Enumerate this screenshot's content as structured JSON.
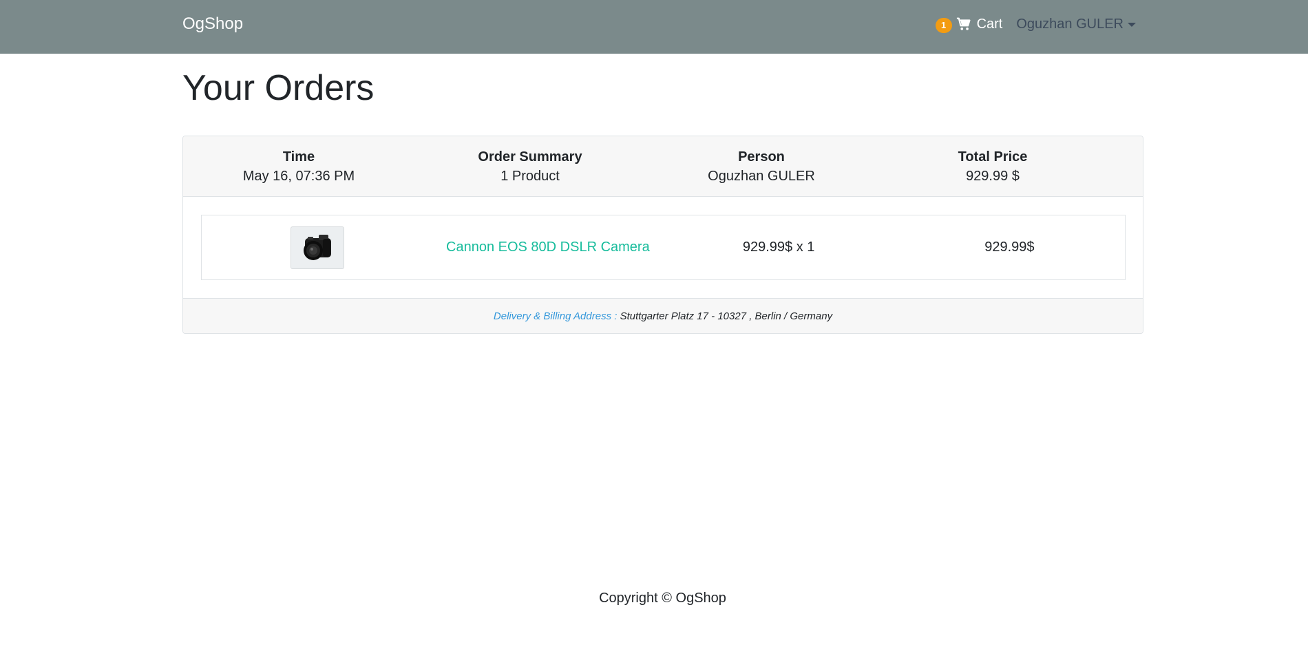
{
  "navbar": {
    "brand": "OgShop",
    "cart_count": "1",
    "cart_label": "Cart",
    "user_name": "Oguzhan GULER",
    "icons": {
      "cart": "shopping-cart-icon",
      "user_menu": "caret-down-icon"
    }
  },
  "page": {
    "title": "Your Orders"
  },
  "order": {
    "header": {
      "time_label": "Time",
      "time_value": "May 16, 07:36 PM",
      "summary_label": "Order Summary",
      "summary_value": "1 Product",
      "person_label": "Person",
      "person_value": "Oguzhan GULER",
      "total_label": "Total Price",
      "total_value": "929.99 $"
    },
    "items": [
      {
        "name": "Cannon EOS 80D DSLR Camera",
        "unit_price_qty": "929.99$ x 1",
        "subtotal": "929.99$",
        "image": "camera-product-image"
      }
    ],
    "address_label": "Delivery & Billing Address :",
    "address_value": "Stuttgarter Platz 17 - 10327 , Berlin / Germany"
  },
  "footer": {
    "copyright": "Copyright © OgShop"
  },
  "colors": {
    "navbar_bg": "#7b8a8b",
    "badge": "#f39c12",
    "link": "#18bc9c",
    "address_label": "#3498db"
  }
}
